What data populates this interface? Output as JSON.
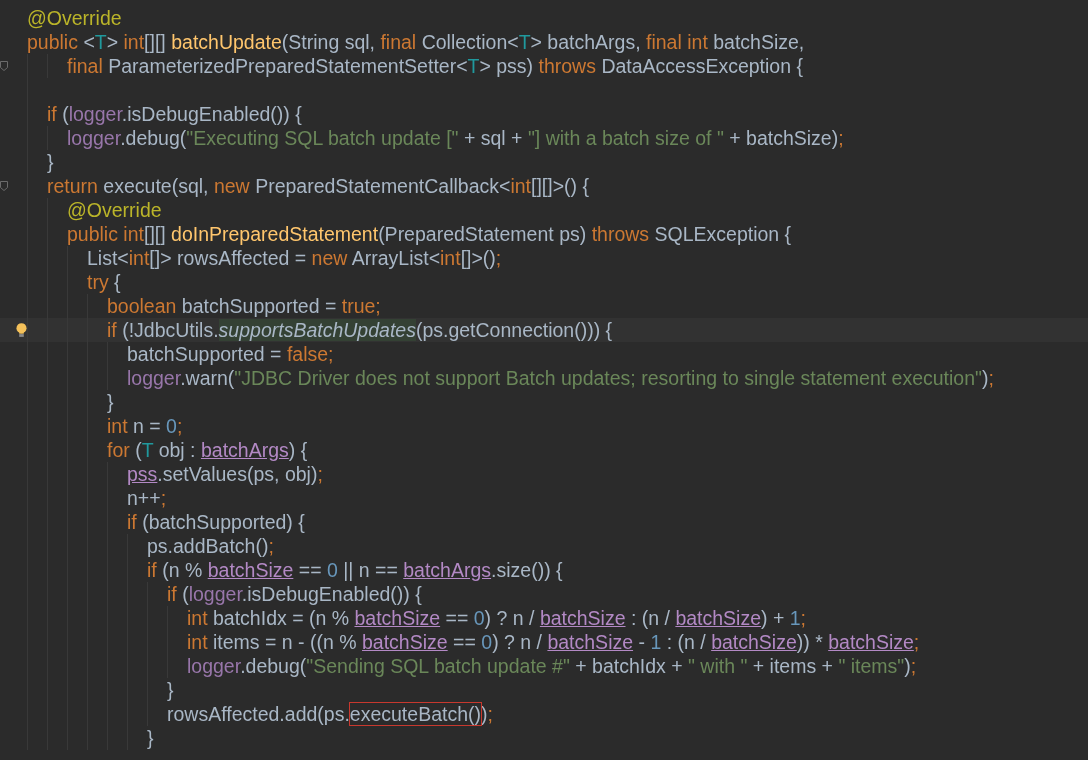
{
  "editor": {
    "lines": [
      {
        "tokens": [
          {
            "kind": "annotation",
            "text": "@Override"
          }
        ]
      },
      {
        "tokens": [
          {
            "kind": "keyword",
            "text": "public "
          },
          {
            "kind": "plain",
            "text": "<"
          },
          {
            "kind": "typeparam",
            "text": "T"
          },
          {
            "kind": "plain",
            "text": "> "
          },
          {
            "kind": "keyword",
            "text": "int"
          },
          {
            "kind": "plain",
            "text": "[][] "
          },
          {
            "kind": "declaration",
            "text": "batchUpdate"
          },
          {
            "kind": "plain",
            "text": "(String sql, "
          },
          {
            "kind": "keyword",
            "text": "final "
          },
          {
            "kind": "plain",
            "text": "Collection<"
          },
          {
            "kind": "typeparam",
            "text": "T"
          },
          {
            "kind": "plain",
            "text": "> batchArgs, "
          },
          {
            "kind": "keyword",
            "text": "final int "
          },
          {
            "kind": "plain",
            "text": "batchSize,"
          }
        ],
        "children": [
          {
            "continuation": true,
            "fold_marker": true,
            "tokens": [
              {
                "kind": "keyword",
                "text": "final "
              },
              {
                "kind": "plain",
                "text": "ParameterizedPreparedStatementSetter<"
              },
              {
                "kind": "typeparam",
                "text": "T"
              },
              {
                "kind": "plain",
                "text": "> pss) "
              },
              {
                "kind": "keyword",
                "text": "throws "
              },
              {
                "kind": "plain",
                "text": "DataAccessException {"
              }
            ]
          },
          {
            "blank": true
          },
          {
            "tokens": [
              {
                "kind": "keyword",
                "text": "if "
              },
              {
                "kind": "plain",
                "text": "("
              },
              {
                "kind": "field",
                "text": "logger"
              },
              {
                "kind": "plain",
                "text": ".isDebugEnabled()) {"
              }
            ],
            "children": [
              {
                "tokens": [
                  {
                    "kind": "field",
                    "text": "logger"
                  },
                  {
                    "kind": "plain",
                    "text": ".debug("
                  },
                  {
                    "kind": "string",
                    "text": "\"Executing SQL batch update [\""
                  },
                  {
                    "kind": "plain",
                    "text": " + sql + "
                  },
                  {
                    "kind": "string",
                    "text": "\"] with a batch size of \""
                  },
                  {
                    "kind": "plain",
                    "text": " + batchSize)"
                  },
                  {
                    "kind": "keyword",
                    "text": ";"
                  }
                ]
              }
            ]
          },
          {
            "tokens": [
              {
                "kind": "plain",
                "text": "}"
              }
            ]
          },
          {
            "fold_marker": true,
            "tokens": [
              {
                "kind": "keyword",
                "text": "return "
              },
              {
                "kind": "plain",
                "text": "execute(sql, "
              },
              {
                "kind": "keyword",
                "text": "new "
              },
              {
                "kind": "plain",
                "text": "PreparedStatementCallback<"
              },
              {
                "kind": "keyword",
                "text": "int"
              },
              {
                "kind": "plain",
                "text": "[][]>() {"
              }
            ],
            "children": [
              {
                "tokens": [
                  {
                    "kind": "annotation",
                    "text": "@Override"
                  }
                ]
              },
              {
                "tokens": [
                  {
                    "kind": "keyword",
                    "text": "public int"
                  },
                  {
                    "kind": "plain",
                    "text": "[][] "
                  },
                  {
                    "kind": "declaration",
                    "text": "doInPreparedStatement"
                  },
                  {
                    "kind": "plain",
                    "text": "(PreparedStatement ps) "
                  },
                  {
                    "kind": "keyword",
                    "text": "throws "
                  },
                  {
                    "kind": "plain",
                    "text": "SQLException {"
                  }
                ],
                "children": [
                  {
                    "tokens": [
                      {
                        "kind": "plain",
                        "text": "List<"
                      },
                      {
                        "kind": "keyword",
                        "text": "int"
                      },
                      {
                        "kind": "plain",
                        "text": "[]> rowsAffected = "
                      },
                      {
                        "kind": "keyword",
                        "text": "new "
                      },
                      {
                        "kind": "plain",
                        "text": "ArrayList<"
                      },
                      {
                        "kind": "keyword",
                        "text": "int"
                      },
                      {
                        "kind": "plain",
                        "text": "[]>()"
                      },
                      {
                        "kind": "keyword",
                        "text": ";"
                      }
                    ]
                  },
                  {
                    "tokens": [
                      {
                        "kind": "keyword",
                        "text": "try "
                      },
                      {
                        "kind": "plain",
                        "text": "{"
                      }
                    ],
                    "children": [
                      {
                        "tokens": [
                          {
                            "kind": "keyword",
                            "text": "boolean "
                          },
                          {
                            "kind": "plain",
                            "text": "batchSupported = "
                          },
                          {
                            "kind": "keyword",
                            "text": "true;"
                          }
                        ]
                      },
                      {
                        "current": true,
                        "intention_bulb": true,
                        "tokens": [
                          {
                            "kind": "keyword",
                            "text": "if "
                          },
                          {
                            "kind": "plain",
                            "text": "(!JdbcUtils."
                          },
                          {
                            "kind": "static",
                            "text": "supportsBatchUpdates"
                          },
                          {
                            "kind": "plain",
                            "text": "(ps.getConnection())) {"
                          }
                        ],
                        "children": [
                          {
                            "tokens": [
                              {
                                "kind": "plain",
                                "text": "batchSupported = "
                              },
                              {
                                "kind": "keyword",
                                "text": "false;"
                              }
                            ]
                          },
                          {
                            "tokens": [
                              {
                                "kind": "field",
                                "text": "logger"
                              },
                              {
                                "kind": "plain",
                                "text": ".warn("
                              },
                              {
                                "kind": "string",
                                "text": "\"JDBC Driver does not support Batch updates; resorting to single statement execution\""
                              },
                              {
                                "kind": "plain",
                                "text": ")"
                              },
                              {
                                "kind": "keyword",
                                "text": ";"
                              }
                            ]
                          }
                        ]
                      },
                      {
                        "tokens": [
                          {
                            "kind": "plain",
                            "text": "}"
                          }
                        ]
                      },
                      {
                        "tokens": [
                          {
                            "kind": "keyword",
                            "text": "int "
                          },
                          {
                            "kind": "plain",
                            "text": "n = "
                          },
                          {
                            "kind": "number",
                            "text": "0"
                          },
                          {
                            "kind": "keyword",
                            "text": ";"
                          }
                        ]
                      },
                      {
                        "tokens": [
                          {
                            "kind": "keyword",
                            "text": "for "
                          },
                          {
                            "kind": "plain",
                            "text": "("
                          },
                          {
                            "kind": "typeparam",
                            "text": "T"
                          },
                          {
                            "kind": "plain",
                            "text": " obj : "
                          },
                          {
                            "kind": "captured",
                            "text": "batchArgs"
                          },
                          {
                            "kind": "plain",
                            "text": ") {"
                          }
                        ],
                        "children": [
                          {
                            "tokens": [
                              {
                                "kind": "captured",
                                "text": "pss"
                              },
                              {
                                "kind": "plain",
                                "text": ".setValues(ps, obj)"
                              },
                              {
                                "kind": "keyword",
                                "text": ";"
                              }
                            ]
                          },
                          {
                            "tokens": [
                              {
                                "kind": "plain",
                                "text": "n++"
                              },
                              {
                                "kind": "keyword",
                                "text": ";"
                              }
                            ]
                          },
                          {
                            "tokens": [
                              {
                                "kind": "keyword",
                                "text": "if "
                              },
                              {
                                "kind": "plain",
                                "text": "(batchSupported) {"
                              }
                            ],
                            "children": [
                              {
                                "tokens": [
                                  {
                                    "kind": "plain",
                                    "text": "ps.addBatch()"
                                  },
                                  {
                                    "kind": "keyword",
                                    "text": ";"
                                  }
                                ]
                              },
                              {
                                "tokens": [
                                  {
                                    "kind": "keyword",
                                    "text": "if "
                                  },
                                  {
                                    "kind": "plain",
                                    "text": "(n % "
                                  },
                                  {
                                    "kind": "captured",
                                    "text": "batchSize"
                                  },
                                  {
                                    "kind": "plain",
                                    "text": " == "
                                  },
                                  {
                                    "kind": "number",
                                    "text": "0"
                                  },
                                  {
                                    "kind": "plain",
                                    "text": " || n == "
                                  },
                                  {
                                    "kind": "captured",
                                    "text": "batchArgs"
                                  },
                                  {
                                    "kind": "plain",
                                    "text": ".size()) {"
                                  }
                                ],
                                "children": [
                                  {
                                    "tokens": [
                                      {
                                        "kind": "keyword",
                                        "text": "if "
                                      },
                                      {
                                        "kind": "plain",
                                        "text": "("
                                      },
                                      {
                                        "kind": "field",
                                        "text": "logger"
                                      },
                                      {
                                        "kind": "plain",
                                        "text": ".isDebugEnabled()) {"
                                      }
                                    ],
                                    "children": [
                                      {
                                        "tokens": [
                                          {
                                            "kind": "keyword",
                                            "text": "int "
                                          },
                                          {
                                            "kind": "plain",
                                            "text": "batchIdx = (n % "
                                          },
                                          {
                                            "kind": "captured",
                                            "text": "batchSize"
                                          },
                                          {
                                            "kind": "plain",
                                            "text": " == "
                                          },
                                          {
                                            "kind": "number",
                                            "text": "0"
                                          },
                                          {
                                            "kind": "plain",
                                            "text": ") ? n / "
                                          },
                                          {
                                            "kind": "captured",
                                            "text": "batchSize"
                                          },
                                          {
                                            "kind": "plain",
                                            "text": " : (n / "
                                          },
                                          {
                                            "kind": "captured",
                                            "text": "batchSize"
                                          },
                                          {
                                            "kind": "plain",
                                            "text": ") + "
                                          },
                                          {
                                            "kind": "number",
                                            "text": "1"
                                          },
                                          {
                                            "kind": "keyword",
                                            "text": ";"
                                          }
                                        ]
                                      },
                                      {
                                        "tokens": [
                                          {
                                            "kind": "keyword",
                                            "text": "int "
                                          },
                                          {
                                            "kind": "plain",
                                            "text": "items = n - ((n % "
                                          },
                                          {
                                            "kind": "captured",
                                            "text": "batchSize"
                                          },
                                          {
                                            "kind": "plain",
                                            "text": " == "
                                          },
                                          {
                                            "kind": "number",
                                            "text": "0"
                                          },
                                          {
                                            "kind": "plain",
                                            "text": ") ? n / "
                                          },
                                          {
                                            "kind": "captured",
                                            "text": "batchSize"
                                          },
                                          {
                                            "kind": "plain",
                                            "text": " - "
                                          },
                                          {
                                            "kind": "number",
                                            "text": "1"
                                          },
                                          {
                                            "kind": "plain",
                                            "text": " : (n / "
                                          },
                                          {
                                            "kind": "captured",
                                            "text": "batchSize"
                                          },
                                          {
                                            "kind": "plain",
                                            "text": ")) * "
                                          },
                                          {
                                            "kind": "captured",
                                            "text": "batchSize"
                                          },
                                          {
                                            "kind": "keyword",
                                            "text": ";"
                                          }
                                        ]
                                      },
                                      {
                                        "tokens": [
                                          {
                                            "kind": "field",
                                            "text": "logger"
                                          },
                                          {
                                            "kind": "plain",
                                            "text": ".debug("
                                          },
                                          {
                                            "kind": "string",
                                            "text": "\"Sending SQL batch update #\""
                                          },
                                          {
                                            "kind": "plain",
                                            "text": " + batchIdx + "
                                          },
                                          {
                                            "kind": "string",
                                            "text": "\" with \""
                                          },
                                          {
                                            "kind": "plain",
                                            "text": " + items + "
                                          },
                                          {
                                            "kind": "string",
                                            "text": "\" items\""
                                          },
                                          {
                                            "kind": "plain",
                                            "text": ")"
                                          },
                                          {
                                            "kind": "keyword",
                                            "text": ";"
                                          }
                                        ]
                                      }
                                    ]
                                  },
                                  {
                                    "tokens": [
                                      {
                                        "kind": "plain",
                                        "text": "}"
                                      }
                                    ]
                                  },
                                  {
                                    "tokens": [
                                      {
                                        "kind": "plain",
                                        "text": "rowsAffected.add(ps."
                                      },
                                      {
                                        "kind": "boxed",
                                        "text": "executeBatch()"
                                      },
                                      {
                                        "kind": "plain",
                                        "text": ")"
                                      },
                                      {
                                        "kind": "keyword",
                                        "text": ";"
                                      }
                                    ]
                                  }
                                ]
                              },
                              {
                                "tokens": [
                                  {
                                    "kind": "plain",
                                    "text": "}"
                                  }
                                ]
                              }
                            ]
                          }
                        ]
                      }
                    ]
                  }
                ]
              }
            ]
          }
        ]
      }
    ]
  }
}
